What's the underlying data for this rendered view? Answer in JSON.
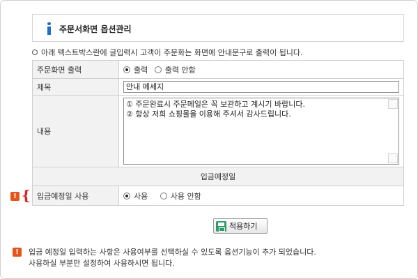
{
  "header": {
    "title": "주문서화면 옵션관리"
  },
  "notice": "아래 텍스트박스란에 글입력시 고객이 주문화는 화면에 안내문구로 출력이 됩니다.",
  "rows": {
    "display": {
      "label": "주문화면 출력",
      "options": [
        "출력",
        "출력 안함"
      ],
      "selected": "출력"
    },
    "title": {
      "label": "제목",
      "value": "안내 메세지"
    },
    "content": {
      "label": "내용",
      "lines": [
        "① 주문완료시 주문메일은 꼭 보관하고 계시기 바랍니다.",
        "② 항상 저희 쇼핑몰을 이용해 주셔서 감사드립니다."
      ]
    },
    "deposit_section": "입금예정일",
    "deposit_use": {
      "label": "입금예정일 사용",
      "options": [
        "사용",
        "사용 안함"
      ],
      "selected": "사용"
    }
  },
  "apply_button": "적용하기",
  "bottom_note": {
    "line1": "입금 예정일 입력하는 사항은 사용여부를 선택하실 수 있도록 옵션기능이 추가 되었습니다.",
    "line2": "사용하실 부분만 설정하여 사용하시면 됩니다."
  },
  "warn_glyph": "!",
  "brace_glyph": "{",
  "colors": {
    "accent_blue": "#1e6fc8",
    "warn_orange": "#e4551c",
    "button_icon_green": "#2e9b6a"
  }
}
